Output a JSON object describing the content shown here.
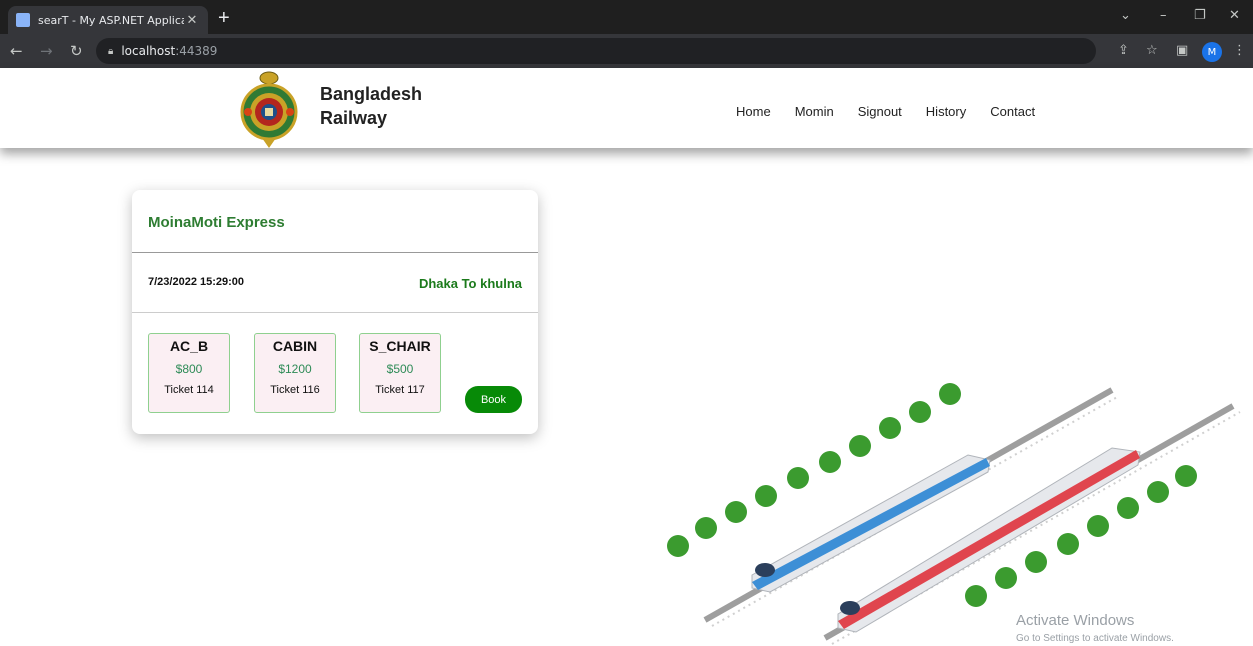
{
  "browser": {
    "tab_title": "searT - My ASP.NET Application",
    "url_host": "localhost",
    "url_port": ":44389",
    "profile_initial": "M"
  },
  "site": {
    "brand_line1": "Bangladesh",
    "brand_line2": "Railway",
    "nav": [
      "Home",
      "Momin",
      "Signout",
      "History",
      "Contact"
    ]
  },
  "train": {
    "name": "MoinaMoti Express",
    "datetime": "7/23/2022 15:29:00",
    "route": "Dhaka To khulna",
    "seats": [
      {
        "class": "AC_B",
        "price": "$800",
        "ticket": "Ticket 114"
      },
      {
        "class": "CABIN",
        "price": "$1200",
        "ticket": "Ticket 116"
      },
      {
        "class": "S_CHAIR",
        "price": "$500",
        "ticket": "Ticket 117"
      }
    ],
    "book_label": "Book"
  },
  "watermark": {
    "line1": "Activate Windows",
    "line2": "Go to Settings to activate Windows."
  },
  "colors": {
    "accent_green": "#078a07",
    "title_green": "#2e7d32",
    "train_blue": "#3d8fd6",
    "train_red": "#e0454e"
  }
}
